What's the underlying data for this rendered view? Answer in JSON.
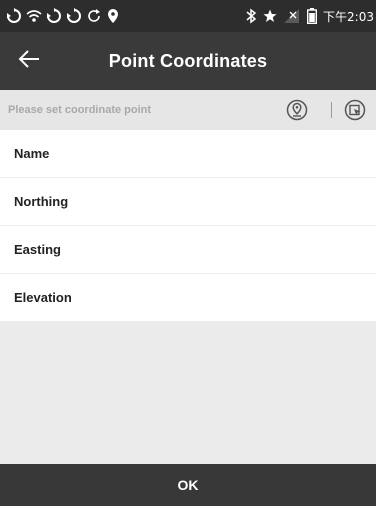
{
  "status_bar": {
    "time": "下午2:03",
    "left_icons": [
      "sync-icon",
      "wifi-icon",
      "sync-icon",
      "sync-icon",
      "reload-icon",
      "location-pin-icon"
    ],
    "right_icons": [
      "bluetooth-icon",
      "star-icon",
      "no-signal-icon",
      "battery-icon"
    ]
  },
  "app_bar": {
    "back_icon": "arrow-left-icon",
    "title": "Point Coordinates"
  },
  "point_bar": {
    "placeholder": "Please set coordinate point",
    "icons": [
      "location-pin-icon",
      "select-point-icon"
    ]
  },
  "fields": [
    {
      "label": "Name"
    },
    {
      "label": "Northing"
    },
    {
      "label": "Easting"
    },
    {
      "label": "Elevation"
    }
  ],
  "footer": {
    "ok_label": "OK"
  },
  "colors": {
    "status_bar": "#2d2d2d",
    "app_bar": "#3a3a3a",
    "point_bar": "#e6e6e6",
    "background": "#ebebeb",
    "footer": "#383838"
  }
}
